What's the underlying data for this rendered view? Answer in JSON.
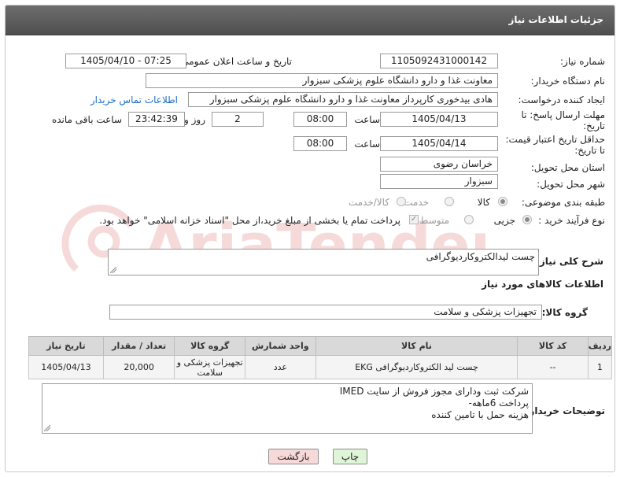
{
  "header": {
    "title": "جزئیات اطلاعات نیاز"
  },
  "fields": {
    "need_number_label": "شماره نیاز:",
    "need_number": "1105092431000142",
    "announce_label": "تاریخ و ساعت اعلان عمومی:",
    "announce_value": "1405/04/10 - 07:25",
    "buyer_org_label": "نام دستگاه خریدار:",
    "buyer_org": "معاونت غذا و دارو   دانشگاه علوم پزشکی سبزوار",
    "requester_label": "ایجاد کننده درخواست:",
    "requester": "هادی بیدخوری کارپرداز معاونت غذا و دارو   دانشگاه علوم پزشکی سبزوار",
    "contact_link": "اطلاعات تماس خریدار",
    "deadline_label_1": "مهلت ارسال پاسخ: تا",
    "deadline_label_2": "تاریخ:",
    "deadline_date": "1405/04/13",
    "time_label": "ساعت",
    "deadline_time": "08:00",
    "days_value": "2",
    "days_label": "روز و",
    "remaining_time": "23:42:39",
    "remaining_label": "ساعت باقی مانده",
    "validity_label_1": "حداقل تاریخ اعتبار قیمت:",
    "validity_label_2": "تا تاریخ:",
    "validity_date": "1405/04/14",
    "validity_time": "08:00",
    "province_label": "استان محل تحویل:",
    "province": "خراسان رضوی",
    "city_label": "شهر محل تحویل:",
    "city": "سبزوار",
    "category_label": "طبقه بندی موضوعی:",
    "category_options": [
      "کالا",
      "خدمت",
      "کالا/خدمت"
    ],
    "category_selected": "کالا",
    "process_label": "نوع فرآیند خرید :",
    "process_options": [
      "جزیی",
      "متوسط"
    ],
    "process_selected": "جزیی",
    "payment_note": "پرداخت تمام یا بخشی از مبلغ خرید،از محل \"اسناد خزانه اسلامی\" خواهد بود."
  },
  "summary": {
    "label": "شرح کلی نیاز:",
    "value": "چست لیدالکتروکاردیوگرافی"
  },
  "goods": {
    "section_title": "اطلاعات کالاهای مورد نیاز",
    "group_label": "گروه کالا:",
    "group_value": "تجهیزات پزشکی و سلامت",
    "columns": [
      "ردیف",
      "کد کالا",
      "نام کالا",
      "واحد شمارش",
      "گروه کالا",
      "تعداد / مقدار",
      "تاریخ نیاز"
    ],
    "rows": [
      [
        "1",
        "--",
        "چست لید الکتروکاردیوگرافی EKG",
        "عدد",
        "تجهیزات پزشکی و سلامت",
        "20,000",
        "1405/04/13"
      ]
    ]
  },
  "buyer_notes": {
    "label": "توضیحات خریدار:",
    "lines": [
      "شرکت ثبت ودارای مجوز فروش از سایت IMED",
      "پرداخت 6ماهه-",
      "هزینه حمل با تامین کننده"
    ]
  },
  "buttons": {
    "print": "چاپ",
    "back": "بازگشت"
  },
  "watermark": {
    "text": "AriaTender.net"
  },
  "colors": {
    "header": "#5a5a5a",
    "link": "#1a6fc4",
    "print_btn": "#dff5d8",
    "back_btn": "#f7d9d9"
  }
}
